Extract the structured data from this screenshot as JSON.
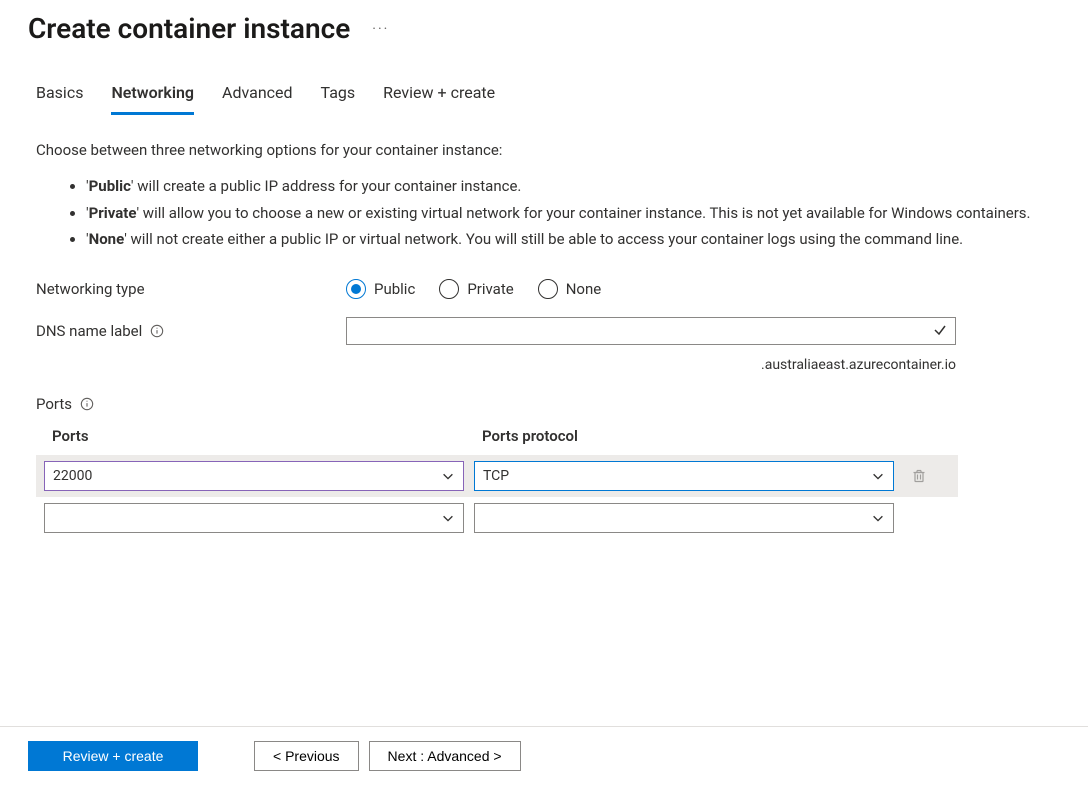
{
  "header": {
    "title": "Create container instance"
  },
  "tabs": {
    "basics": "Basics",
    "networking": "Networking",
    "advanced": "Advanced",
    "tags": "Tags",
    "review": "Review + create"
  },
  "intro": "Choose between three networking options for your container instance:",
  "bullets": {
    "public_label": "Public",
    "public_text": "' will create a public IP address for your container instance.",
    "private_label": "Private",
    "private_text": "' will allow you to choose a new or existing virtual network for your container instance. This is not yet available for Windows containers.",
    "none_label": "None",
    "none_text": "' will not create either a public IP or virtual network. You will still be able to access your container logs using the command line."
  },
  "fields": {
    "networking_type_label": "Networking type",
    "radio_public": "Public",
    "radio_private": "Private",
    "radio_none": "None",
    "dns_label": "DNS name label",
    "dns_value": "",
    "dns_suffix": ".australiaeast.azurecontainer.io"
  },
  "ports": {
    "section_label": "Ports",
    "col_ports": "Ports",
    "col_protocol": "Ports protocol",
    "row1_port": "22000",
    "row1_protocol": "TCP",
    "row2_port": "",
    "row2_protocol": ""
  },
  "footer": {
    "review": "Review + create",
    "previous": "< Previous",
    "next": "Next : Advanced >"
  }
}
